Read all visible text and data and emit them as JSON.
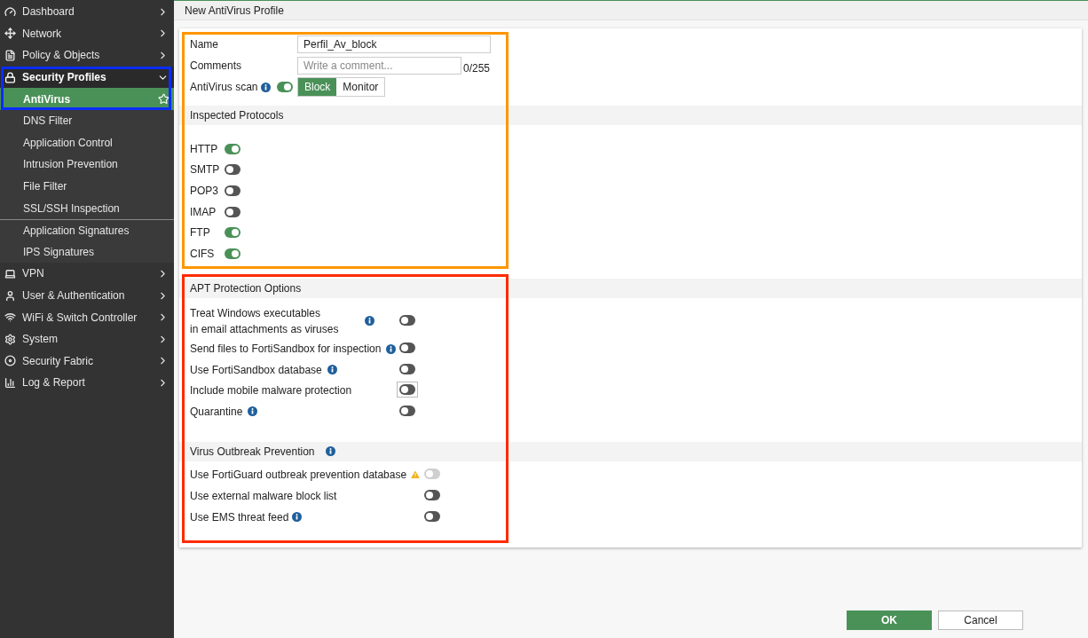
{
  "sidebar": {
    "items": [
      {
        "label": "Dashboard",
        "expanded": false,
        "selected": false
      },
      {
        "label": "Network",
        "expanded": false,
        "selected": false
      },
      {
        "label": "Policy & Objects",
        "expanded": false,
        "selected": false
      },
      {
        "label": "Security Profiles",
        "expanded": true,
        "selected": true,
        "children": [
          {
            "label": "AntiVirus",
            "selected": true,
            "separator_before": false
          },
          {
            "label": "DNS Filter",
            "selected": false,
            "separator_before": false
          },
          {
            "label": "Application Control",
            "selected": false,
            "separator_before": false
          },
          {
            "label": "Intrusion Prevention",
            "selected": false,
            "separator_before": false
          },
          {
            "label": "File Filter",
            "selected": false,
            "separator_before": false
          },
          {
            "label": "SSL/SSH Inspection",
            "selected": false,
            "separator_before": false
          },
          {
            "label": "Application Signatures",
            "selected": false,
            "separator_before": true
          },
          {
            "label": "IPS Signatures",
            "selected": false,
            "separator_before": false
          }
        ]
      },
      {
        "label": "VPN",
        "expanded": false,
        "selected": false
      },
      {
        "label": "User & Authentication",
        "expanded": false,
        "selected": false
      },
      {
        "label": "WiFi & Switch Controller",
        "expanded": false,
        "selected": false
      },
      {
        "label": "System",
        "expanded": false,
        "selected": false
      },
      {
        "label": "Security Fabric",
        "expanded": false,
        "selected": false
      },
      {
        "label": "Log & Report",
        "expanded": false,
        "selected": false
      }
    ]
  },
  "page_title": "New AntiVirus Profile",
  "form": {
    "name_label": "Name",
    "name_value": "Perfil_Av_block",
    "comments_label": "Comments",
    "comments_placeholder": "Write a comment...",
    "comments_counter": "0/255",
    "scan_label": "AntiVirus scan",
    "scan_on": true,
    "scan_modes": [
      {
        "label": "Block",
        "selected": true
      },
      {
        "label": "Monitor",
        "selected": false
      }
    ]
  },
  "protocols": {
    "title": "Inspected Protocols",
    "items": [
      {
        "label": "HTTP",
        "on": true
      },
      {
        "label": "SMTP",
        "on": false
      },
      {
        "label": "POP3",
        "on": false
      },
      {
        "label": "IMAP",
        "on": false
      },
      {
        "label": "FTP",
        "on": true
      },
      {
        "label": "CIFS",
        "on": true
      }
    ]
  },
  "apt": {
    "title": "APT Protection Options",
    "items": [
      {
        "label_lines": [
          "Treat Windows executables",
          "in email attachments as viruses"
        ],
        "info": true,
        "on": false,
        "focused": false
      },
      {
        "label_lines": [
          "Send files to FortiSandbox for inspection"
        ],
        "info": true,
        "on": false,
        "focused": false
      },
      {
        "label_lines": [
          "Use FortiSandbox database"
        ],
        "info": true,
        "on": false,
        "focused": false
      },
      {
        "label_lines": [
          "Include mobile malware protection"
        ],
        "info": false,
        "on": false,
        "focused": true
      },
      {
        "label_lines": [
          "Quarantine"
        ],
        "info": true,
        "on": false,
        "focused": false
      }
    ]
  },
  "outbreak": {
    "title": "Virus Outbreak Prevention",
    "info": true,
    "items": [
      {
        "label": "Use FortiGuard outbreak prevention database",
        "warning": true,
        "info": false,
        "on": false,
        "disabled": true
      },
      {
        "label": "Use external malware block list",
        "warning": false,
        "info": false,
        "on": false,
        "disabled": false
      },
      {
        "label": "Use EMS threat feed",
        "warning": false,
        "info": true,
        "on": false,
        "disabled": false
      }
    ]
  },
  "buttons": [
    {
      "label": "OK",
      "kind": "primary"
    },
    {
      "label": "Cancel",
      "kind": "secondary"
    }
  ]
}
